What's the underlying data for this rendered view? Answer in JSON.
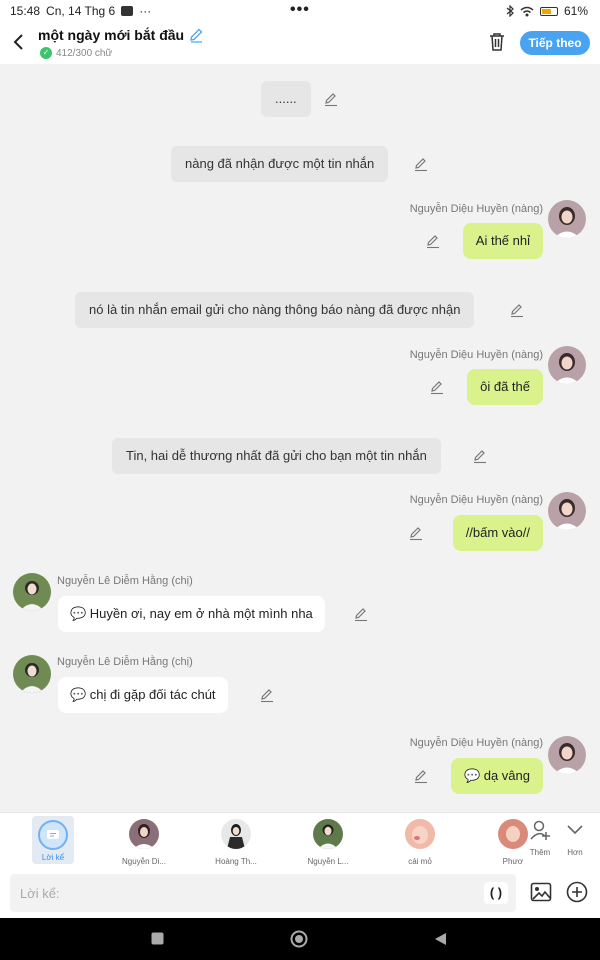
{
  "status_bar": {
    "time": "15:48",
    "date": "Cn, 14 Thg 6",
    "dots": "•••",
    "battery": "61%"
  },
  "header": {
    "title": "một ngày mới bắt đầu",
    "word_count": "412/300 chữ",
    "follow_label": "Tiếp theo"
  },
  "messages": [
    {
      "type": "narration",
      "text": "......"
    },
    {
      "type": "narration",
      "text": "nàng đã nhận được một tin nhắn"
    },
    {
      "type": "me",
      "name": "Nguyễn Diệu Huyền (nàng)",
      "text": "Ai thế nhỉ"
    },
    {
      "type": "narration",
      "text": "nó là tin nhắn email gửi cho nàng thông báo nàng đã được nhận"
    },
    {
      "type": "me",
      "name": "Nguyễn Diệu Huyền (nàng)",
      "text": "ôi đã thế"
    },
    {
      "type": "narration",
      "text": "Tin, hai dễ thương nhất đã gửi cho bạn một tin nhắn"
    },
    {
      "type": "me",
      "name": "Nguyễn Diệu Huyền (nàng)",
      "text": "//bấm vào//"
    },
    {
      "type": "other",
      "name": "Nguyễn Lê Diễm Hằng (chị)",
      "text": "💬 Huyền ơi, nay em ở nhà một mình nha"
    },
    {
      "type": "other",
      "name": "Nguyễn Lê Diễm Hằng (chị)",
      "text": "💬 chị đi gặp đối tác chút"
    },
    {
      "type": "me",
      "name": "Nguyễn Diệu Huyền (nàng)",
      "text": "💬 dạ vâng"
    }
  ],
  "characters": {
    "narrator_label": "Lời kể",
    "items": [
      {
        "label": "Nguyễn Di...",
        "color": "#8a6f78"
      },
      {
        "label": "Hoàng Th...",
        "color": "#2b2b2b"
      },
      {
        "label": "Nguyễn L...",
        "color": "#5e7a4a"
      },
      {
        "label": "cái mỏ",
        "color": "#f0b9a8"
      },
      {
        "label": "Phươ",
        "color": "#d98a7a"
      }
    ],
    "add_label": "Thêm",
    "more_label": "Hơn"
  },
  "input": {
    "placeholder": "Lời kể:",
    "paren_label": "( )"
  },
  "colors": {
    "accent": "#4aa3f0",
    "my_bubble": "#d9f28c",
    "narration_bg": "#e6e6e6"
  }
}
